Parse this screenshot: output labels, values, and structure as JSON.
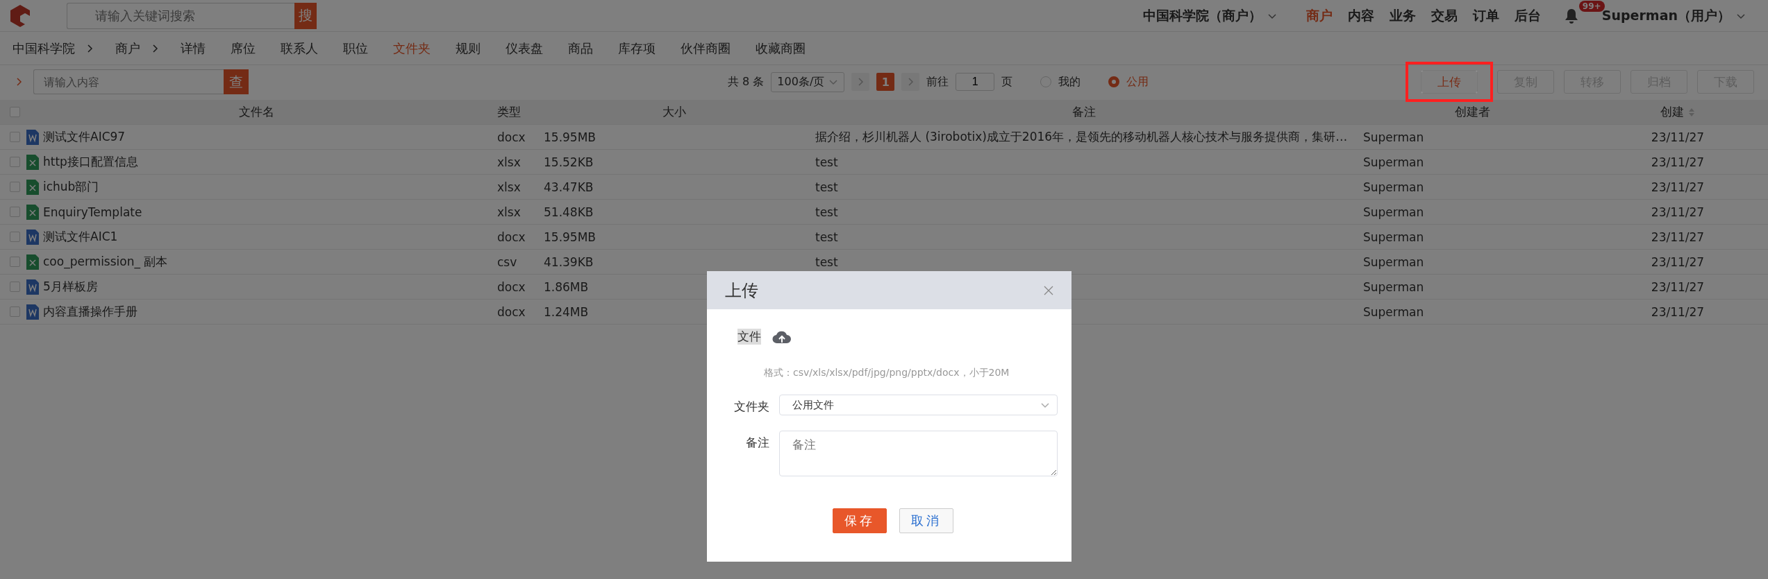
{
  "header": {
    "search_placeholder": "请输入关键词搜索",
    "search_button": "搜",
    "org": "中国科学院（商户）",
    "menu": [
      {
        "label": "商户",
        "selected": true
      },
      {
        "label": "内容",
        "selected": false
      },
      {
        "label": "业务",
        "selected": false
      },
      {
        "label": "交易",
        "selected": false
      },
      {
        "label": "订单",
        "selected": false
      },
      {
        "label": "后台",
        "selected": false
      }
    ],
    "notification_badge": "99+",
    "user": "Superman（用户）"
  },
  "breadcrumb": [
    "中国科学院",
    "商户"
  ],
  "tabs": [
    {
      "label": "详情",
      "selected": false
    },
    {
      "label": "席位",
      "selected": false
    },
    {
      "label": "联系人",
      "selected": false
    },
    {
      "label": "职位",
      "selected": false
    },
    {
      "label": "文件夹",
      "selected": true
    },
    {
      "label": "规则",
      "selected": false
    },
    {
      "label": "仪表盘",
      "selected": false
    },
    {
      "label": "商品",
      "selected": false
    },
    {
      "label": "库存项",
      "selected": false
    },
    {
      "label": "伙伴商圈",
      "selected": false
    },
    {
      "label": "收藏商圈",
      "selected": false
    }
  ],
  "toolbar": {
    "search_placeholder": "请输入内容",
    "search_button": "查",
    "total": "共 8 条",
    "page_size": "100条/页",
    "current_page": "1",
    "goto_label": "前往",
    "goto_value": "1",
    "page_label": "页",
    "scope": [
      {
        "label": "我的",
        "selected": false
      },
      {
        "label": "公用",
        "selected": true
      }
    ],
    "actions": [
      {
        "label": "上传",
        "disabled": false,
        "highlighted": true
      },
      {
        "label": "复制",
        "disabled": true,
        "highlighted": false
      },
      {
        "label": "转移",
        "disabled": true,
        "highlighted": false
      },
      {
        "label": "归档",
        "disabled": true,
        "highlighted": false
      },
      {
        "label": "下载",
        "disabled": true,
        "highlighted": false
      }
    ]
  },
  "table": {
    "all_checked": false,
    "columns": [
      "文件名",
      "类型",
      "大小",
      "备注",
      "创建者",
      "创建"
    ],
    "rows": [
      {
        "checked": false,
        "kind": "word",
        "name": "测试文件AIC97",
        "type": "docx",
        "size": "15.95MB",
        "note": "据介绍，杉川机器人 (3irobotix)成立于2016年，是领先的移动机器人核心技术与服务提供商，集研…",
        "creator": "Superman",
        "created": "23/11/27"
      },
      {
        "checked": false,
        "kind": "excel",
        "name": "http接口配置信息",
        "type": "xlsx",
        "size": "15.52KB",
        "note": "test",
        "creator": "Superman",
        "created": "23/11/27"
      },
      {
        "checked": false,
        "kind": "excel",
        "name": "ichub部门",
        "type": "xlsx",
        "size": "43.47KB",
        "note": "test",
        "creator": "Superman",
        "created": "23/11/27"
      },
      {
        "checked": false,
        "kind": "excel",
        "name": "EnquiryTemplate",
        "type": "xlsx",
        "size": "51.48KB",
        "note": "test",
        "creator": "Superman",
        "created": "23/11/27"
      },
      {
        "checked": false,
        "kind": "word",
        "name": "测试文件AIC1",
        "type": "docx",
        "size": "15.95MB",
        "note": "test",
        "creator": "Superman",
        "created": "23/11/27"
      },
      {
        "checked": false,
        "kind": "excel",
        "name": "coo_permission_ 副本",
        "type": "csv",
        "size": "41.39KB",
        "note": "test",
        "creator": "Superman",
        "created": "23/11/27"
      },
      {
        "checked": false,
        "kind": "word",
        "name": "5月样板房",
        "type": "docx",
        "size": "1.86MB",
        "creator": "Superman",
        "created": "23/11/27"
      },
      {
        "checked": false,
        "kind": "word",
        "name": "内容直播操作手册",
        "type": "docx",
        "size": "1.24MB",
        "creator": "Superman",
        "created": "23/11/27"
      }
    ]
  },
  "dialog": {
    "title": "上传",
    "file_label": "文件",
    "format_hint": "格式：csv/xls/xlsx/pdf/jpg/png/pptx/docx，小于20M",
    "folder_label": "文件夹",
    "folder_value": "公用文件",
    "note_label": "备注",
    "note_placeholder": "备注",
    "save": "保存",
    "cancel": "取消"
  }
}
